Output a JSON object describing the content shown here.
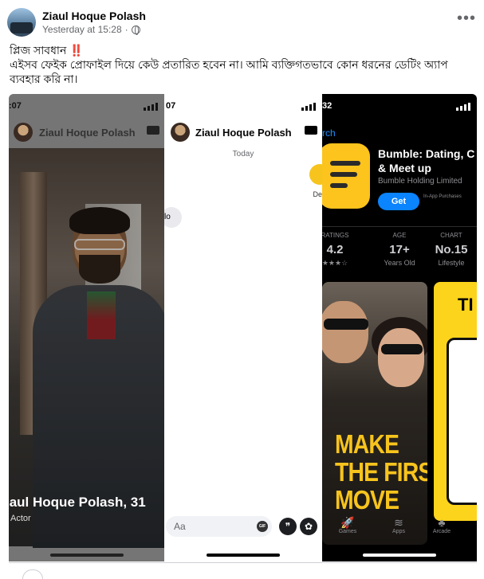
{
  "post": {
    "author": "Ziaul Hoque Polash",
    "timestamp": "Yesterday at 15:28",
    "privacy_sep": "·",
    "more_label": "•••",
    "line1": "প্লিজ সাবধান ",
    "line1_emoji": "‼️",
    "line2": "এইসব ফেইক প্রোফাইল দিয়ে কেউ প্রতারিত হবেন না। আমি ব্যক্তিগতভাবে কোন ধরনের ডেটিং অ্যাপ ব্যবহার করি না।"
  },
  "shot1": {
    "time": ":07",
    "header_name": "Ziaul Hoque Polash",
    "overlay_name": "iaul Hoque Polash, 31",
    "job": "Actor"
  },
  "shot2": {
    "time": "07",
    "header_name": "Ziaul Hoque Polash",
    "today": "Today",
    "right_fragment": "De",
    "left_fragment": "lo",
    "compose_placeholder": "Aa",
    "gif_label": "GIF"
  },
  "shot3": {
    "time": "32",
    "back_label": "rch",
    "app_title_1": "Bumble: Dating, C",
    "app_title_2": "& Meet up",
    "developer": "Bumble Holding Limited",
    "get_label": "Get",
    "iap_label": "In-App Purchases",
    "stats": [
      {
        "label": "RATINGS",
        "value": "4.2",
        "sub": "★★★☆"
      },
      {
        "label": "AGE",
        "value": "17+",
        "sub": "Years Old"
      },
      {
        "label": "CHART",
        "value": "No.15",
        "sub": "Lifestyle"
      }
    ],
    "tagline_1": "MAKE",
    "tagline_2": "THE FIRST",
    "tagline_3": "MOVE",
    "promo2_text": "TI",
    "tabs": [
      {
        "label": "Games"
      },
      {
        "label": "Apps"
      },
      {
        "label": "Arcade"
      }
    ]
  }
}
